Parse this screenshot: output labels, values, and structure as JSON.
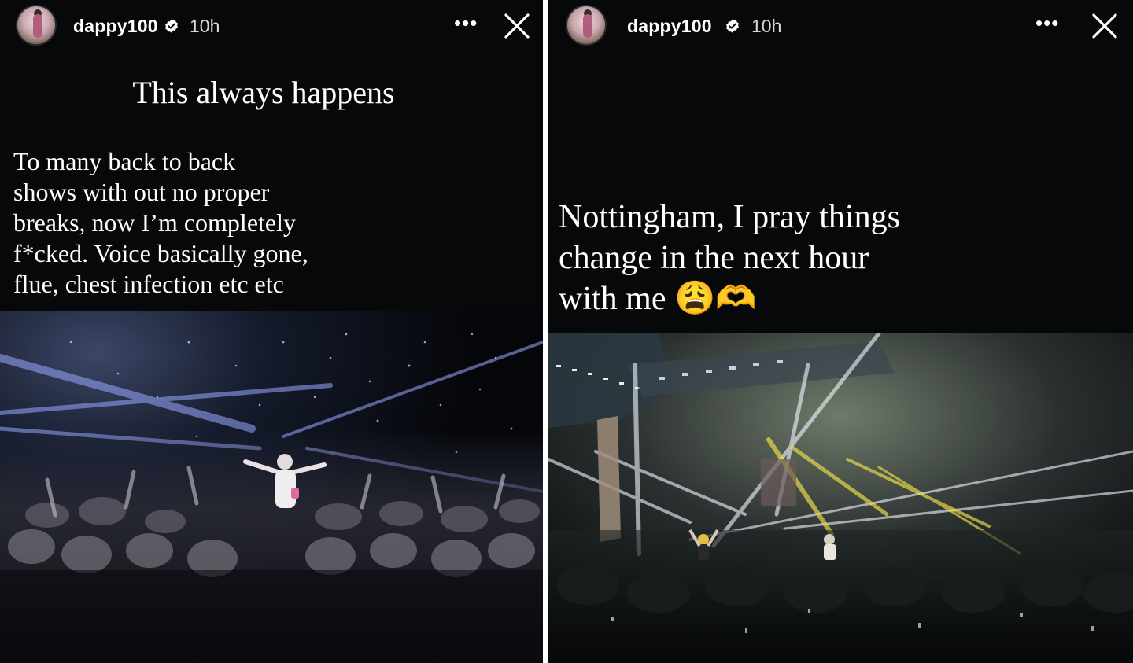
{
  "stories": [
    {
      "username": "dappy100",
      "time": "10h",
      "more_label": "•••",
      "title": "This always happens",
      "body_lines": [
        "To many back to back",
        "shows with out no proper",
        "breaks, now I’m completely",
        "f*cked. Voice basically gone,",
        "flue, chest infection etc etc"
      ]
    },
    {
      "username": "dappy100",
      "time": "10h",
      "more_label": "•••",
      "body_lines": [
        "Nottingham, I pray things",
        "change in the next hour",
        "with me 😩🫶"
      ]
    }
  ],
  "icons": {
    "verified": "verified-badge-icon",
    "more": "more-options-icon",
    "close": "close-icon"
  },
  "colors": {
    "story_bg": "#07080a",
    "text": "#ffffff",
    "divider": "#ffffff"
  }
}
